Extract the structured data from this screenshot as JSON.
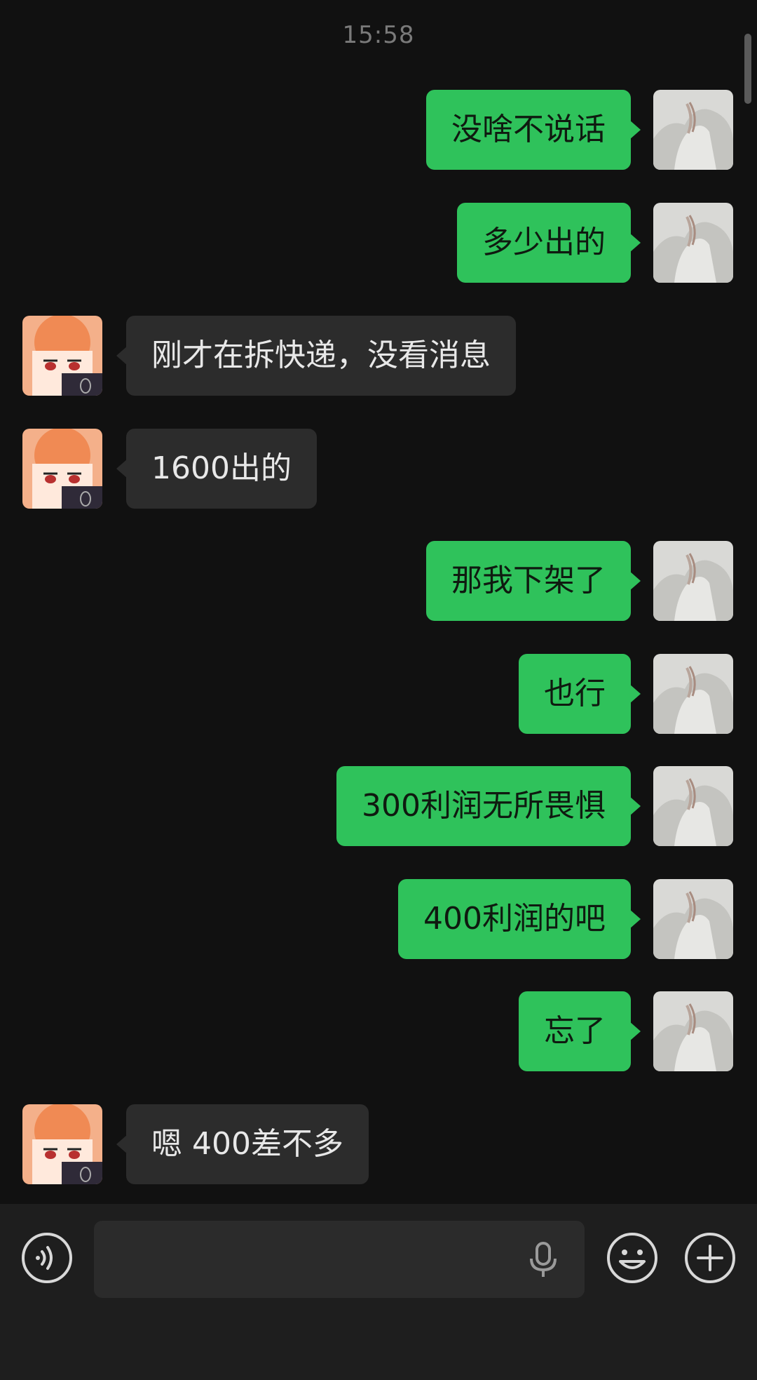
{
  "chat": {
    "timestamp": "15:58",
    "messages": [
      {
        "side": "right",
        "text": "没啥不说话"
      },
      {
        "side": "right",
        "text": "多少出的"
      },
      {
        "side": "left",
        "text": "刚才在拆快递，没看消息"
      },
      {
        "side": "left",
        "text": "1600出的"
      },
      {
        "side": "right",
        "text": "那我下架了"
      },
      {
        "side": "right",
        "text": "也行"
      },
      {
        "side": "right",
        "text": "300利润无所畏惧"
      },
      {
        "side": "right",
        "text": "400利润的吧"
      },
      {
        "side": "right",
        "text": "忘了"
      },
      {
        "side": "left",
        "text": "嗯 400差不多"
      }
    ]
  },
  "input": {
    "value": "",
    "placeholder": ""
  },
  "icons": {
    "voice": "voice-message-icon",
    "mic": "microphone-icon",
    "emoji": "emoji-icon",
    "plus": "plus-icon"
  },
  "colors": {
    "background": "#111111",
    "outgoing_bubble": "#2fc25b",
    "incoming_bubble": "#2c2c2c",
    "input_bar": "#1e1e1e"
  }
}
